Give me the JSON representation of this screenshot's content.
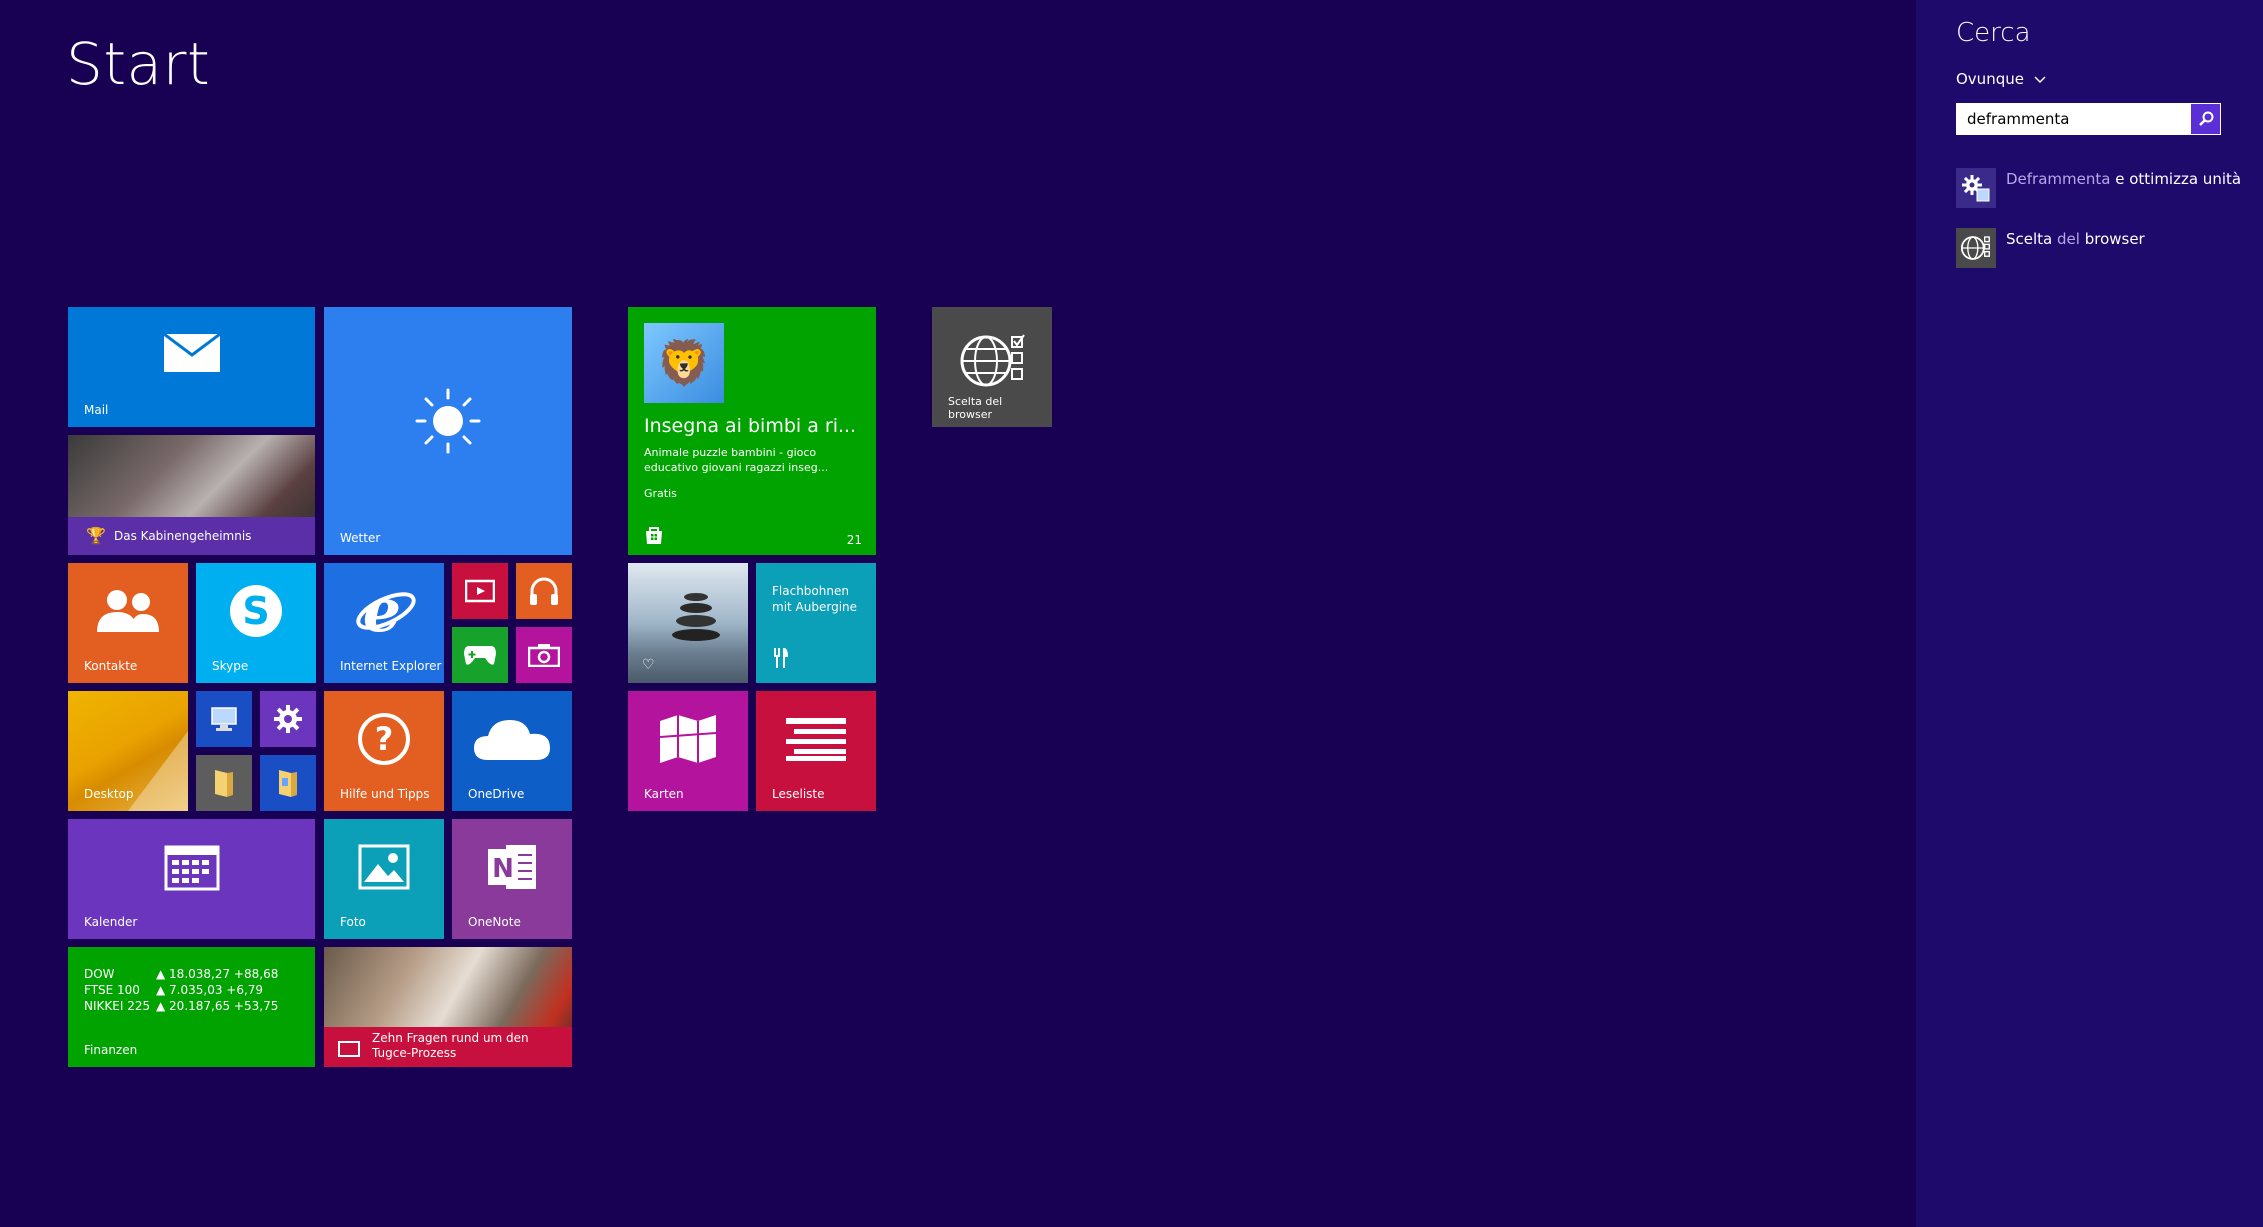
{
  "start_title": "Start",
  "colors": {
    "background": "#180052",
    "search_pane": "#1d0a6b",
    "mail": "#0078d7",
    "weather": "#2d7ff0",
    "store_tile": "#00a300",
    "people": "#e25e21",
    "skype": "#00aff0",
    "ie": "#1e70e2",
    "finance": "#00a300",
    "news": "#c8103e",
    "calendar": "#6b36bd",
    "photos": "#0b9fb8",
    "onenote": "#8a3a9b"
  },
  "tiles": {
    "mail": {
      "label": "Mail",
      "icon": "mail-icon"
    },
    "sport": {
      "label": "Das Kabinengeheimnis",
      "icon": "trophy-icon"
    },
    "weather": {
      "label": "Wetter",
      "icon": "sun-icon"
    },
    "people": {
      "label": "Kontakte",
      "icon": "people-icon"
    },
    "skype": {
      "label": "Skype",
      "icon": "skype-icon"
    },
    "ie": {
      "label": "Internet Explorer",
      "icon": "internet-explorer-icon"
    },
    "video": {
      "icon": "video-icon"
    },
    "music": {
      "icon": "headphones-icon"
    },
    "games": {
      "icon": "gamepad-icon"
    },
    "camera": {
      "icon": "camera-icon"
    },
    "desktop": {
      "label": "Desktop"
    },
    "this_pc": {
      "icon": "computer-icon"
    },
    "settings": {
      "icon": "gear-icon"
    },
    "explorer": {
      "icon": "folder-icon"
    },
    "documents": {
      "icon": "documents-folder-icon"
    },
    "help": {
      "label": "Hilfe und Tipps",
      "icon": "question-icon"
    },
    "onedrive": {
      "label": "OneDrive",
      "icon": "cloud-icon"
    },
    "calendar": {
      "label": "Kalender",
      "icon": "calendar-icon"
    },
    "photos": {
      "label": "Foto",
      "icon": "photo-icon"
    },
    "onenote": {
      "label": "OneNote",
      "icon": "onenote-icon"
    },
    "finance": {
      "label": "Finanzen",
      "rows": [
        {
          "index": "DOW",
          "value": "▲ 18.038,27 +88,68"
        },
        {
          "index": "FTSE 100",
          "value": "▲ 7.035,03 +6,79"
        },
        {
          "index": "NIKKEI 225",
          "value": "▲ 20.187,65 +53,75"
        }
      ]
    },
    "news": {
      "label": "Zehn Fragen rund um den Tugce-Prozess",
      "icon": "news-icon"
    },
    "store_app": {
      "title": "Insegna ai bimbi a ri...",
      "description": "Animale puzzle bambini - gioco educativo giovani ragazzi inseg...",
      "price": "Gratis",
      "count": "21",
      "icon": "store-icon"
    },
    "health": {
      "icon": "heart-pulse-icon"
    },
    "food": {
      "label": "Flachbohnen mit Aubergine",
      "icon": "fork-knife-icon"
    },
    "maps": {
      "label": "Karten",
      "icon": "map-icon"
    },
    "reading": {
      "label": "Leseliste",
      "icon": "reading-list-icon"
    },
    "browser_choice": {
      "label": "Scelta del browser",
      "icon": "globe-checklist-icon"
    }
  },
  "search": {
    "title": "Cerca",
    "scope": "Ovunque",
    "query": "deframmenta",
    "results": [
      {
        "highlight": "Deframmenta",
        "rest": " e ottimizza unità",
        "icon": "defrag-icon"
      },
      {
        "pre": "Scelta ",
        "highlight": "del",
        "rest": " browser",
        "icon": "globe-checklist-icon"
      }
    ]
  }
}
